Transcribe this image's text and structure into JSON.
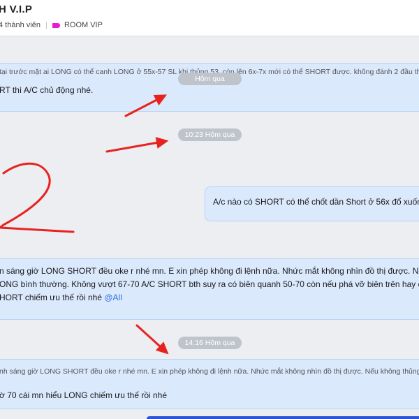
{
  "header": {
    "title": "H V.I.P",
    "member_count": "4 thành viên",
    "room_tag": "ROOM VIP",
    "tag_color": "#e81ccf"
  },
  "messages": {
    "first_reply_quote": "tại trước mặt ai LONG có thể canh LONG ở 55x-57 SL khi thủng 53, còn lên 6x-7x mới có thể SHORT được. không đánh 2 đầu thì ca",
    "first_text": "RT thì A/C chủ động nhé.",
    "sent_text": "A/c nào có SHORT có thể chốt dần Short ở 56x đổ xuống",
    "long_line1": "n sáng giờ LONG SHORT đều oke r nhé mn. E xin phép không đi lệnh nữa. Nhức mắt không nhìn đồ thị được. Nếu k",
    "long_line2": "ONG bình thường. Không vượt 67-70 A/C SHORT bth suy ra có biên quanh 50-70 còn nếu phá vỡ biên trên hay dư",
    "long_line3": "HORT chiếm ưu thế rồi nhé",
    "long_mention": "@All",
    "last_reply_quote": "nh sáng giờ LONG SHORT đều oke r nhé mn. E xin phép không đi lệnh nữa. Nhức mắt không nhìn đồ thị được. Nếu không thủng 50-",
    "last_text": "ờ 70 cái mn hiểu LONG chiếm ưu thế rồi nhé"
  },
  "timestamps": {
    "t1": "Hôm qua",
    "t2": "10:23 Hôm qua",
    "t3": "14:16 Hôm qua"
  },
  "annotation": {
    "arrow_color": "#e8231f"
  }
}
